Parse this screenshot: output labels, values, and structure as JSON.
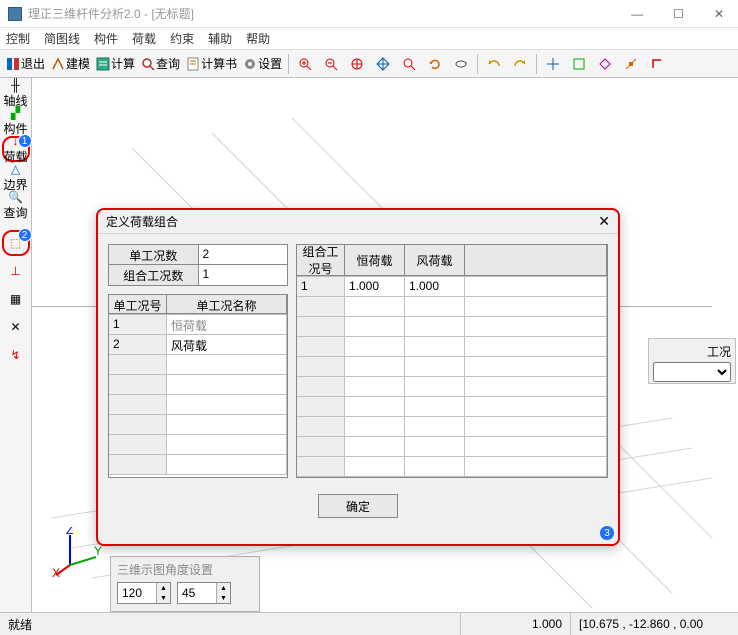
{
  "window": {
    "title": "理正三维杆件分析2.0 - [无标题]"
  },
  "win_btns": {
    "min": "—",
    "max": "☐",
    "close": "✕"
  },
  "menu": [
    "控制",
    "简图线",
    "构件",
    "荷载",
    "约束",
    "辅助",
    "帮助"
  ],
  "toolbar_text": [
    "退出",
    "建模",
    "计算",
    "查询",
    "计算书",
    "设置"
  ],
  "left_tools": [
    "轴线",
    "构件",
    "荷载",
    "边界",
    "查询"
  ],
  "badges": {
    "b1": "1",
    "b2": "2",
    "b3": "3"
  },
  "angle": {
    "label": "三维示图角度设置",
    "v1": "120",
    "v2": "45"
  },
  "right_panel": {
    "label": "工况"
  },
  "status": {
    "left": "就绪",
    "val": "1.000",
    "coords": "[10.675 , -12.860 , 0.00"
  },
  "dialog": {
    "title": "定义荷载组合",
    "top_table": [
      {
        "k": "单工况数",
        "v": "2"
      },
      {
        "k": "组合工况数",
        "v": "1"
      }
    ],
    "case_headers": [
      "单工况号",
      "单工况名称"
    ],
    "cases": [
      {
        "no": "1",
        "name": "恒荷载"
      },
      {
        "no": "2",
        "name": "风荷载"
      }
    ],
    "combo_headers": [
      "组合工况号",
      "恒荷载",
      "风荷载"
    ],
    "combos": [
      {
        "no": "1",
        "a": "1.000",
        "b": "1.000"
      }
    ],
    "ok": "确定"
  }
}
